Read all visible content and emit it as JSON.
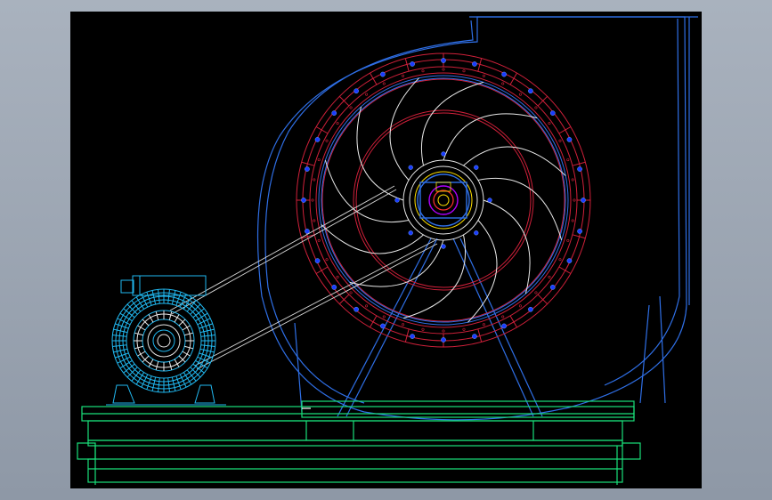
{
  "colors": {
    "background": "#000000",
    "chrome": "#9aa3af",
    "housing": "#2f6fe6",
    "wheel_ring": "#d0203a",
    "bolts": "#1a3cff",
    "blades": "#e8e8e8",
    "motor": "#21b8f0",
    "base_frame": "#19e07a",
    "belt": "#d8d8d8",
    "hub": "#b000ff"
  },
  "drawing": {
    "view": "centrifugal-fan-side-elevation",
    "blade_count": 12,
    "wheel_bolt_count": 28,
    "motor_fin_count": 56
  }
}
